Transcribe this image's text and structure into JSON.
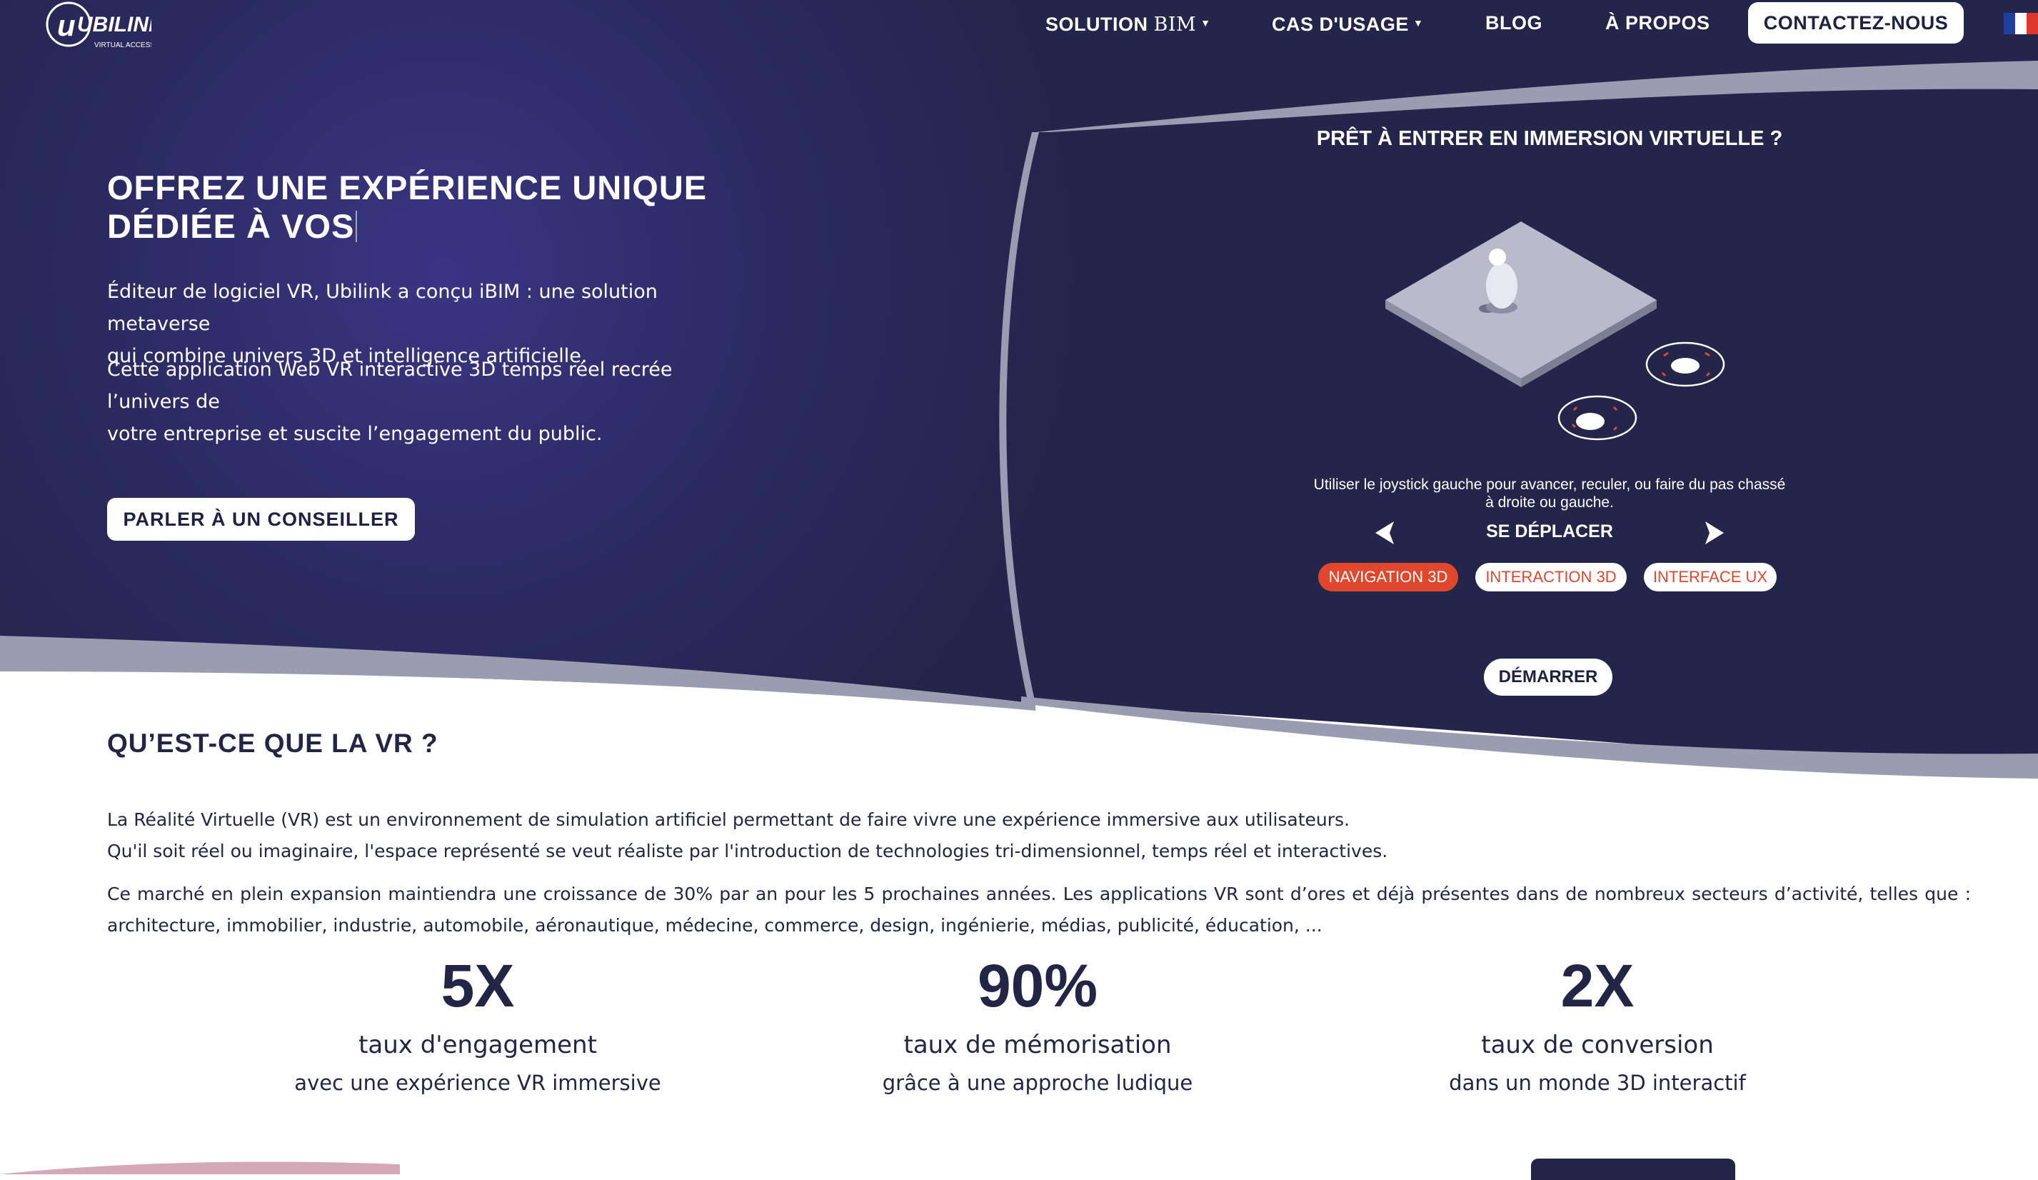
{
  "colors": {
    "hero_background": "#24254a",
    "accent_orange": "#e0472c",
    "text_dark": "#232546",
    "swoosh_grey": "#9a9cb1"
  },
  "brand": {
    "logo_text": "UBILINK",
    "logo_tagline": "VIRTUAL ACCESS"
  },
  "nav": {
    "solution": "SOLUTION ",
    "solution_brand": "BIM",
    "cas_usage": "CAS D'USAGE",
    "blog": "BLOG",
    "a_propos": "À PROPOS",
    "contact": "CONTACTEZ-NOUS",
    "language_flag": "french-flag-icon"
  },
  "hero": {
    "title_line1": "OFFREZ UNE EXPÉRIENCE UNIQUE",
    "title_line2": "DÉDIÉE À VOS",
    "paragraph1_line1": "Éditeur de logiciel VR, Ubilink a conçu iBIM : une solution metaverse",
    "paragraph1_line2": "qui combine univers 3D et intelligence artificielle.",
    "paragraph2_line1": "Cette application Web VR interactive 3D temps réel recrée l’univers de",
    "paragraph2_line2": "votre entreprise et suscite l’engagement du public.",
    "cta": "PARLER À UN CONSEILLER"
  },
  "immersion": {
    "title": "PRÊT À ENTRER EN IMMERSION VIRTUELLE ?",
    "description_line1": "Utiliser le joystick gauche pour avancer, reculer, ou faire du pas chassé",
    "description_line2": "à droite ou gauche.",
    "step_label": "SE DÉPLACER",
    "tabs": [
      {
        "label": "NAVIGATION 3D",
        "active": true
      },
      {
        "label": "INTERACTION 3D",
        "active": false
      },
      {
        "label": "INTERFACE UX",
        "active": false
      }
    ],
    "start": "DÉMARRER"
  },
  "vr_section": {
    "title": "QU’EST-CE QUE LA VR ?",
    "p1_line1": "La Réalité Virtuelle (VR) est un environnement de simulation artificiel permettant de faire vivre une expérience immersive aux utilisateurs.",
    "p1_line2": "Qu'il soit réel ou imaginaire, l'espace représenté se veut réaliste par l'introduction de technologies tri-dimensionnel, temps réel et interactives.",
    "p2": "Ce marché en plein expansion maintiendra une croissance de 30% par an pour les 5 prochaines années. Les applications VR sont d’ores et déjà présentes dans de nombreux secteurs d’activité, telles que : architecture, immobilier, industrie, automobile, aéronautique, médecine, commerce, design, ingénierie, médias, publicité, éducation, ..."
  },
  "stats": [
    {
      "value": "5X",
      "label": "taux d'engagement",
      "sub": "avec une expérience VR immersive"
    },
    {
      "value": "90%",
      "label": "taux de mémorisation",
      "sub": "grâce à une approche ludique"
    },
    {
      "value": "2X",
      "label": "taux de conversion",
      "sub": "dans un monde 3D interactif"
    }
  ]
}
